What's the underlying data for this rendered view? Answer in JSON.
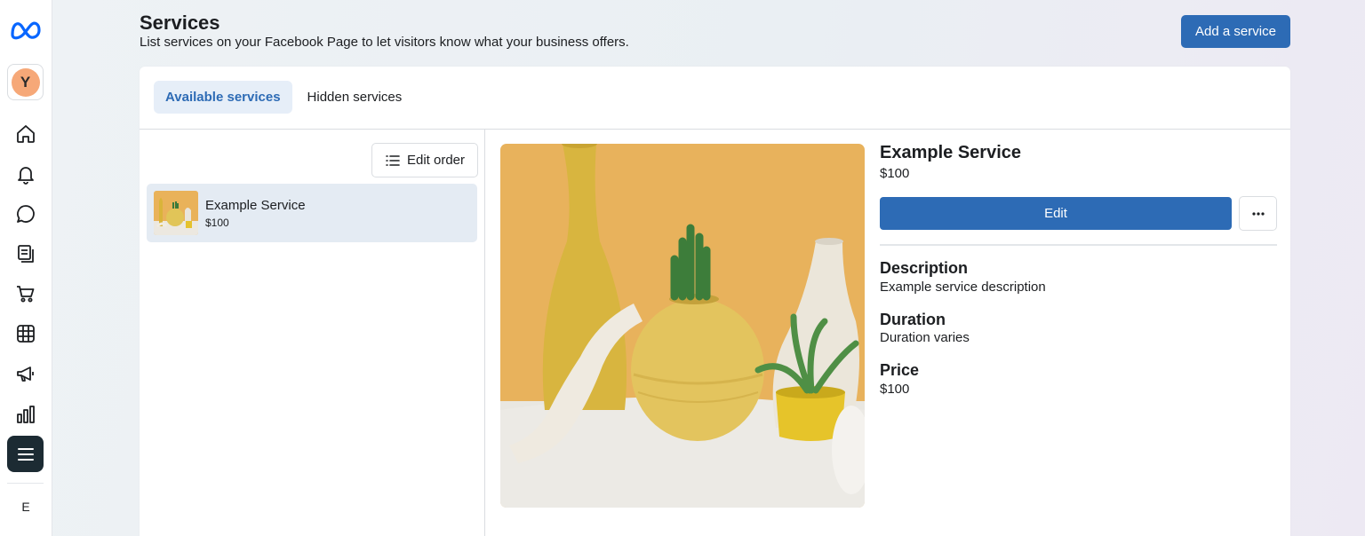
{
  "rail": {
    "avatar_letter": "Y",
    "bottom_letter": "E",
    "items": [
      {
        "icon": "home-icon"
      },
      {
        "icon": "bell-icon"
      },
      {
        "icon": "chat-bubble-icon"
      },
      {
        "icon": "posts-icon"
      },
      {
        "icon": "shopping-cart-icon"
      },
      {
        "icon": "table-grid-icon"
      },
      {
        "icon": "megaphone-icon"
      },
      {
        "icon": "bar-chart-icon"
      },
      {
        "icon": "hamburger-menu-icon"
      }
    ]
  },
  "header": {
    "title": "Services",
    "subtitle": "List services on your Facebook Page to let visitors know what your business offers.",
    "add_button": "Add a service"
  },
  "tabs": [
    {
      "label": "Available services",
      "active": true
    },
    {
      "label": "Hidden services",
      "active": false
    }
  ],
  "list": {
    "edit_order_label": "Edit order",
    "items": [
      {
        "name": "Example Service",
        "price": "$100"
      }
    ]
  },
  "detail": {
    "title": "Example Service",
    "price": "$100",
    "edit_label": "Edit",
    "more_icon": "more-horizontal-icon",
    "fields": [
      {
        "label": "Description",
        "value": "Example service description"
      },
      {
        "label": "Duration",
        "value": "Duration varies"
      },
      {
        "label": "Price",
        "value": "$100"
      }
    ]
  },
  "colors": {
    "primary": "#2d6bb5",
    "active_tab_bg": "#e6eef8",
    "selected_item_bg": "#e4ebf3",
    "avatar": "#f6a878"
  }
}
